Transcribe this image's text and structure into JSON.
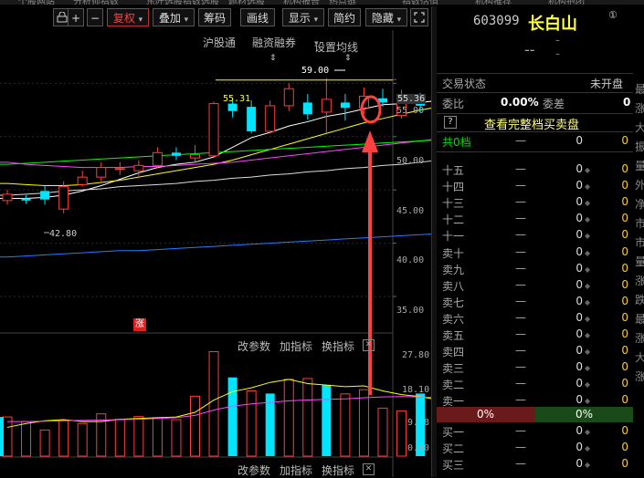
{
  "top_menu": [
    "个股网站",
    "分析师指数",
    "东阡选股",
    "指数选股",
    "题材选股",
    "机构报告",
    "热点链",
    "指数估值",
    "机构推荐",
    "机构抱团"
  ],
  "toolbar": {
    "first_btn": "",
    "plus": "+",
    "minus": "−",
    "fuquan": "复权",
    "diejia": "叠加",
    "chouma": "筹码",
    "huaxian": "画线",
    "xianshi": "显示",
    "jianyue": "简约",
    "yincang": "隐藏",
    "expand_icon": "expand-icon"
  },
  "chart": {
    "links": [
      "沪股通",
      "融资融券",
      "设置均线"
    ],
    "price_axis": [
      "55.36",
      "55.00",
      "50.00",
      "45.00",
      "40.00",
      "35.00"
    ],
    "annot_high": "59.00",
    "annot_low": "42.80",
    "annot_line": "55.31",
    "badge": "涨",
    "vol_axis": [
      "27.80",
      "18.10",
      "9.18",
      "0.00"
    ],
    "sub_toolbar": [
      "改参数",
      "加指标",
      "换指标"
    ],
    "colors": {
      "up": "#ff3c3c",
      "down": "#00e5ff",
      "ma5": "#ffffff",
      "ma10": "#ffff00",
      "ma20": "#ff44ff",
      "ma60": "#00ff00",
      "ma120": "#dddddd",
      "ma250": "#2080ff",
      "arrow": "#ff4040"
    }
  },
  "chart_data": {
    "type": "candlestick",
    "ylim": [
      32,
      60
    ],
    "candles": [
      {
        "o": 44.0,
        "c": 44.6,
        "h": 45.0,
        "l": 43.6
      },
      {
        "o": 44.2,
        "c": 44.0,
        "h": 44.5,
        "l": 43.7
      },
      {
        "o": 44.9,
        "c": 44.1,
        "h": 45.4,
        "l": 43.6
      },
      {
        "o": 43.2,
        "c": 45.3,
        "h": 45.8,
        "l": 42.8
      },
      {
        "o": 45.5,
        "c": 46.2,
        "h": 46.8,
        "l": 45.3
      },
      {
        "o": 46.2,
        "c": 47.1,
        "h": 47.6,
        "l": 45.8
      },
      {
        "o": 47.0,
        "c": 47.0,
        "h": 47.6,
        "l": 46.4
      },
      {
        "o": 46.8,
        "c": 47.3,
        "h": 47.8,
        "l": 46.1
      },
      {
        "o": 47.3,
        "c": 48.5,
        "h": 49.0,
        "l": 47.0
      },
      {
        "o": 48.5,
        "c": 48.2,
        "h": 49.0,
        "l": 47.8
      },
      {
        "o": 48.0,
        "c": 48.3,
        "h": 49.2,
        "l": 47.6
      },
      {
        "o": 48.2,
        "c": 53.1,
        "h": 53.3,
        "l": 48.0
      },
      {
        "o": 53.1,
        "c": 52.4,
        "h": 53.6,
        "l": 51.8
      },
      {
        "o": 52.8,
        "c": 50.5,
        "h": 53.4,
        "l": 50.3
      },
      {
        "o": 50.5,
        "c": 52.9,
        "h": 53.4,
        "l": 50.3
      },
      {
        "o": 52.9,
        "c": 54.5,
        "h": 55.0,
        "l": 52.4
      },
      {
        "o": 53.2,
        "c": 52.1,
        "h": 54.0,
        "l": 51.6
      },
      {
        "o": 52.3,
        "c": 53.5,
        "h": 55.5,
        "l": 50.3
      },
      {
        "o": 53.2,
        "c": 52.7,
        "h": 54.0,
        "l": 51.5
      },
      {
        "o": 52.7,
        "c": 53.8,
        "h": 54.6,
        "l": 52.1
      },
      {
        "o": 53.6,
        "c": 53.2,
        "h": 54.5,
        "l": 52.8
      },
      {
        "o": 52.0,
        "c": 53.8,
        "h": 54.4,
        "l": 51.7
      },
      {
        "o": 53.2,
        "c": 52.9,
        "h": 54.1,
        "l": 52.3
      },
      {
        "o": 52.6,
        "c": 53.3,
        "h": 53.8,
        "l": 52.3
      },
      {
        "o": 53.0,
        "c": 53.0,
        "h": 54.2,
        "l": 52.6
      },
      {
        "o": 53.0,
        "c": 54.8,
        "h": 55.6,
        "l": 52.4
      },
      {
        "o": 54.0,
        "c": 55.4,
        "h": 56.5,
        "l": 53.4
      },
      {
        "o": 54.9,
        "c": 57.9,
        "h": 59.0,
        "l": 54.6
      }
    ],
    "volume": {
      "max": 27.8,
      "values": [
        10.2,
        9.0,
        6.8,
        9.3,
        8.5,
        11.0,
        9.6,
        10.3,
        10.0,
        9.5,
        15.6,
        27.2,
        20.5,
        17.0,
        16.3,
        20.0,
        20.2,
        18.5,
        16.2,
        17.3,
        12.5,
        11.8,
        16.3,
        13.9,
        11.5,
        13.5,
        17.2,
        27.8
      ],
      "up": [
        true,
        true,
        true,
        true,
        true,
        true,
        true,
        true,
        true,
        true,
        true,
        true,
        false,
        true,
        false,
        true,
        true,
        false,
        true,
        true,
        true,
        true,
        false,
        true,
        true,
        true,
        true,
        true
      ]
    },
    "ma": {
      "ma5": [
        44.2,
        44.2,
        44.3,
        44.5,
        44.9,
        45.4,
        46.0,
        46.6,
        47.1,
        47.4,
        47.6,
        48.1,
        49.0,
        49.9,
        50.4,
        51.0,
        51.4,
        51.9,
        52.2,
        52.6,
        53.0,
        53.1,
        53.2,
        53.4,
        53.5,
        53.9,
        54.6,
        55.3
      ],
      "ma10": [
        45.6,
        45.5,
        45.4,
        45.4,
        45.5,
        45.7,
        45.9,
        46.2,
        46.5,
        46.8,
        47.1,
        47.4,
        47.8,
        48.3,
        48.8,
        49.3,
        49.8,
        50.3,
        50.8,
        51.3,
        51.7,
        52.1,
        52.5,
        52.8,
        53.0,
        53.3,
        53.6,
        54.0
      ],
      "ma20": [
        47.6,
        47.4,
        47.3,
        47.2,
        47.1,
        47.1,
        47.1,
        47.2,
        47.2,
        47.3,
        47.4,
        47.5,
        47.6,
        47.8,
        48.0,
        48.2,
        48.4,
        48.6,
        48.8,
        49.0,
        49.2,
        49.4,
        49.6,
        49.8,
        50.0,
        50.2,
        50.5,
        50.9
      ],
      "ma60": [
        47.4,
        47.5,
        47.6,
        47.7,
        47.8,
        47.9,
        48.0,
        48.1,
        48.2,
        48.3,
        48.4,
        48.5,
        48.6,
        48.7,
        48.8,
        48.9,
        49.0,
        49.1,
        49.2,
        49.3,
        49.4,
        49.5,
        49.6,
        49.7,
        49.8,
        49.9,
        50.1,
        50.4
      ],
      "ma120": [
        44.5,
        44.6,
        44.7,
        44.9,
        45.0,
        45.1,
        45.3,
        45.4,
        45.5,
        45.6,
        45.8,
        45.9,
        46.1,
        46.2,
        46.4,
        46.5,
        46.7,
        46.8,
        47.0,
        47.1,
        47.3,
        47.4,
        47.6,
        47.8,
        48.0,
        48.2,
        48.4,
        48.6
      ],
      "ma250": [
        38.7,
        38.8,
        38.9,
        39.0,
        39.1,
        39.2,
        39.3,
        39.3,
        39.4,
        39.5,
        39.6,
        39.7,
        39.8,
        39.9,
        40.0,
        40.1,
        40.2,
        40.3,
        40.4,
        40.5,
        40.6,
        40.7,
        40.8,
        40.9,
        41.0,
        41.1,
        41.3,
        41.5
      ]
    },
    "vol_ma5": [
      7.5,
      8.5,
      9.2,
      9.5,
      9.0,
      9.0,
      9.6,
      9.8,
      10.0,
      10.2,
      11.4,
      14.6,
      16.8,
      17.8,
      19.2,
      20.0,
      18.9,
      18.5,
      18.1,
      18.3,
      17.0,
      16.0,
      15.5,
      14.6,
      14.0,
      13.8,
      14.8,
      16.5
    ],
    "vol_ma10": [
      9.0,
      9.0,
      9.1,
      9.2,
      9.3,
      9.4,
      9.5,
      9.6,
      9.8,
      10.0,
      10.6,
      12.0,
      13.0,
      13.6,
      14.0,
      14.4,
      14.6,
      14.8,
      14.9,
      15.2,
      15.4,
      15.5,
      15.4,
      15.2,
      15.0,
      15.0,
      15.1,
      15.3
    ]
  },
  "panel": {
    "code": "603099",
    "name": "长白山",
    "info_icon": "①",
    "price": "--",
    "chg1": "–",
    "chg2": "–",
    "status_label": "交易状态",
    "status_value": "未开盘",
    "weibi_label": "委比",
    "weibi_value": "0.00%",
    "weicha_label": "委差",
    "weicha_value": "0",
    "help": "?",
    "full_book": "查看完整档买卖盘",
    "total_label": "共0档",
    "total_dash": "—",
    "total_vol": "0",
    "total_val": "0",
    "ask_rows": [
      {
        "label": "十五",
        "dash": "—",
        "vol": "0",
        "val": "0"
      },
      {
        "label": "十四",
        "dash": "—",
        "vol": "0",
        "val": "0"
      },
      {
        "label": "十三",
        "dash": "—",
        "vol": "0",
        "val": "0"
      },
      {
        "label": "十二",
        "dash": "—",
        "vol": "0",
        "val": "0"
      },
      {
        "label": "十一",
        "dash": "—",
        "vol": "0",
        "val": "0"
      },
      {
        "label": "卖十",
        "dash": "—",
        "vol": "0",
        "val": "0"
      },
      {
        "label": "卖九",
        "dash": "—",
        "vol": "0",
        "val": "0"
      },
      {
        "label": "卖八",
        "dash": "—",
        "vol": "0",
        "val": "0"
      },
      {
        "label": "卖七",
        "dash": "—",
        "vol": "0",
        "val": "0"
      },
      {
        "label": "卖六",
        "dash": "—",
        "vol": "0",
        "val": "0"
      },
      {
        "label": "卖五",
        "dash": "—",
        "vol": "0",
        "val": "0"
      },
      {
        "label": "卖四",
        "dash": "—",
        "vol": "0",
        "val": "0"
      },
      {
        "label": "卖三",
        "dash": "—",
        "vol": "0",
        "val": "0"
      },
      {
        "label": "卖二",
        "dash": "—",
        "vol": "0",
        "val": "0"
      },
      {
        "label": "卖一",
        "dash": "—",
        "vol": "0",
        "val": "0"
      }
    ],
    "ratio_left": "0%",
    "ratio_right": "0%",
    "bid_rows": [
      {
        "label": "买一",
        "dash": "—",
        "vol": "0",
        "val": "0"
      },
      {
        "label": "买二",
        "dash": "—",
        "vol": "0",
        "val": "0"
      },
      {
        "label": "买三",
        "dash": "—",
        "vol": "0",
        "val": "0"
      }
    ]
  },
  "right_strip": [
    "最",
    "涨",
    "大",
    "振",
    "量",
    "外",
    "净",
    "市",
    "市",
    "量",
    "涨",
    "跌",
    "最",
    "涨",
    "大",
    "涨"
  ]
}
